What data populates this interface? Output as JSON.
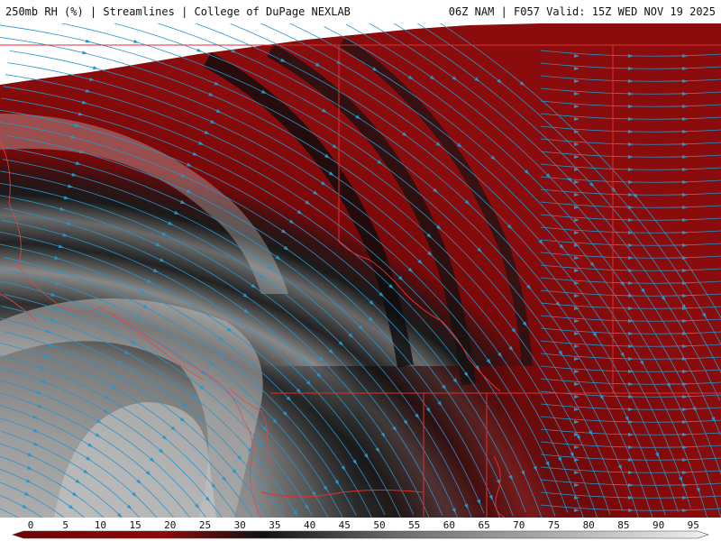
{
  "header": {
    "title_left": "250mb RH (%) | Streamlines | College of DuPage NEXLAB",
    "title_right": "06Z NAM | F057 Valid: 15Z WED NOV 19 2025"
  },
  "colorbar": {
    "labels": [
      "0",
      "5",
      "10",
      "15",
      "20",
      "25",
      "30",
      "35",
      "40",
      "45",
      "50",
      "55",
      "60",
      "65",
      "70",
      "75",
      "80",
      "85",
      "90",
      "95"
    ],
    "colors": {
      "dry": "#6e0505",
      "dry_mid": "#8c0a0a",
      "dark_band": "#1a1a1a",
      "moist": "#b4b4b4",
      "saturated": "#f0f0f0"
    }
  },
  "map": {
    "streamline_color": "#2a95c8",
    "boundary_color": "#e03030",
    "coast_color": "#e04848"
  }
}
